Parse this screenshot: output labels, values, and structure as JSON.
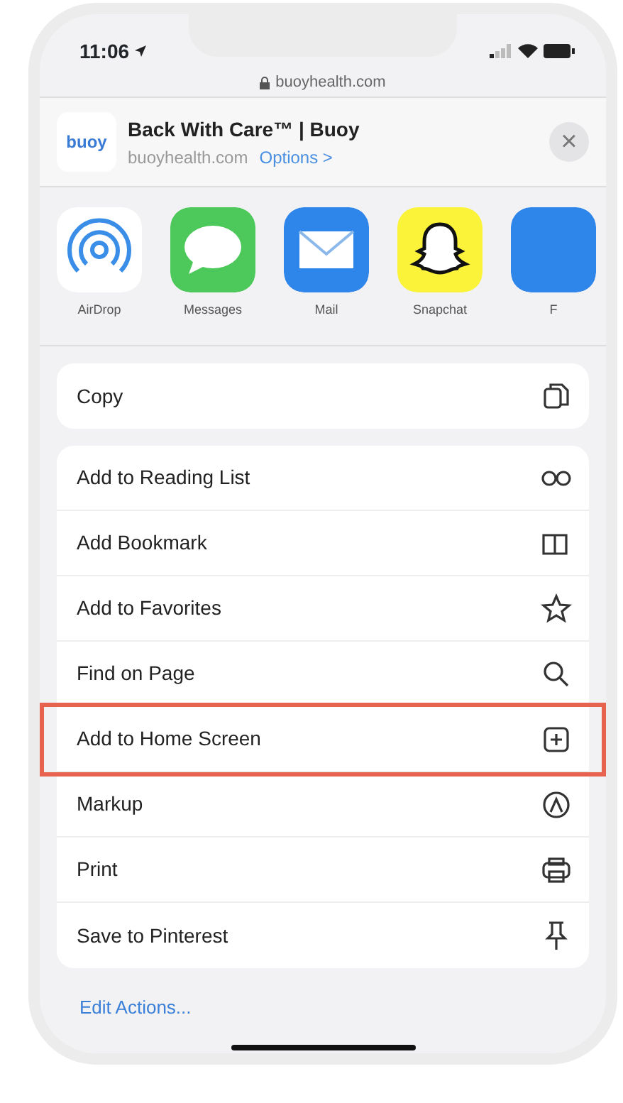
{
  "status_bar": {
    "time": "11:06"
  },
  "url_bar": {
    "domain": "buoyhealth.com"
  },
  "share_header": {
    "logo_text": "buoy",
    "title": "Back With Care™ | Buoy",
    "subtitle": "buoyhealth.com",
    "options_link": "Options >",
    "close": "×"
  },
  "apps": [
    {
      "kind": "airdrop",
      "label": "AirDrop"
    },
    {
      "kind": "messages",
      "label": "Messages"
    },
    {
      "kind": "mail",
      "label": "Mail"
    },
    {
      "kind": "snapchat",
      "label": "Snapchat"
    },
    {
      "kind": "partial",
      "label": "F"
    }
  ],
  "action_groups": [
    {
      "items": [
        {
          "kind": "copy",
          "label": "Copy",
          "highlighted": false
        }
      ]
    },
    {
      "items": [
        {
          "kind": "reading-list",
          "label": "Add to Reading List",
          "highlighted": false
        },
        {
          "kind": "bookmark",
          "label": "Add Bookmark",
          "highlighted": false
        },
        {
          "kind": "favorite",
          "label": "Add to Favorites",
          "highlighted": false
        },
        {
          "kind": "find",
          "label": "Find on Page",
          "highlighted": false
        },
        {
          "kind": "add-home",
          "label": "Add to Home Screen",
          "highlighted": true
        },
        {
          "kind": "markup",
          "label": "Markup",
          "highlighted": false
        },
        {
          "kind": "print",
          "label": "Print",
          "highlighted": false
        },
        {
          "kind": "pin",
          "label": "Save to Pinterest",
          "highlighted": false
        }
      ]
    }
  ],
  "edit_actions": "Edit Actions..."
}
